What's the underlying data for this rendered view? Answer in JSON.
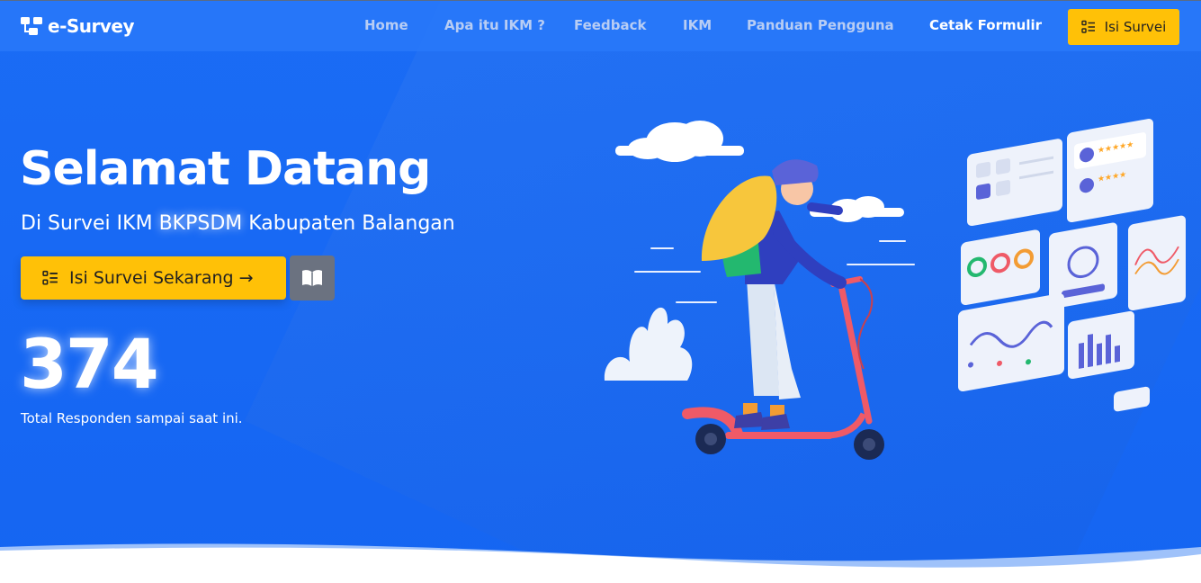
{
  "brand": {
    "name": "e-Survey"
  },
  "nav": {
    "home": "Home",
    "about": "Apa itu IKM ?",
    "feedback": "Feedback",
    "ikm": "IKM",
    "guide": "Panduan Pengguna",
    "print": "Cetak Formulir",
    "survey_button": "Isi Survei"
  },
  "hero": {
    "title": "Selamat Datang",
    "subtitle_pre": "Di Survei IKM ",
    "subtitle_highlight": "BKPSDM",
    "subtitle_post": " Kabupaten Balangan",
    "cta_label": "Isi Survei Sekarang →",
    "respondent_count": "374",
    "respondent_label": "Total Responden sampai saat ini."
  },
  "colors": {
    "primary": "#1a6cf5",
    "accent": "#ffc107",
    "secondary_button": "#6b7280",
    "nav_text": "#b8cdf4"
  },
  "icons": [
    "logo-icon",
    "list-check-icon",
    "book-open-icon"
  ]
}
